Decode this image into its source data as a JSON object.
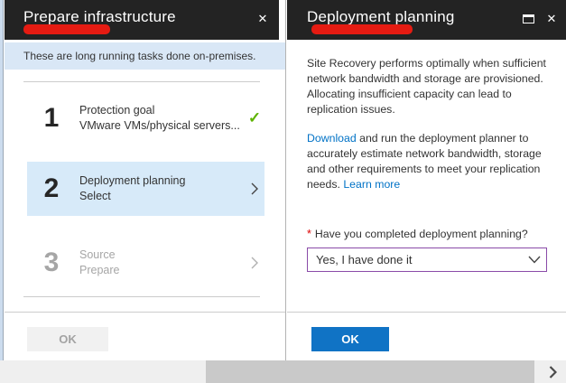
{
  "left_blade": {
    "title": "Prepare infrastructure",
    "banner_text": "These are long running tasks done on-premises.",
    "steps": [
      {
        "number": "1",
        "title": "Protection goal",
        "subtitle": "VMware VMs/physical servers...",
        "state": "completed"
      },
      {
        "number": "2",
        "title": "Deployment planning",
        "subtitle": "Select",
        "state": "selected"
      },
      {
        "number": "3",
        "title": "Source",
        "subtitle": "Prepare",
        "state": "disabled"
      }
    ],
    "ok_button": {
      "label": "OK",
      "enabled": false
    }
  },
  "right_blade": {
    "title": "Deployment planning",
    "intro_paragraph": "Site Recovery performs optimally when sufficient network bandwidth and storage are provisioned. Allocating insufficient capacity can lead to replication issues.",
    "planner_paragraph": {
      "download_link": "Download",
      "middle_text": " and run the deployment planner to accurately estimate network bandwidth, storage and other requirements to meet your replication needs. ",
      "learn_more_link": "Learn more"
    },
    "question": {
      "required_marker": "*",
      "label": "Have you completed deployment planning?"
    },
    "dropdown": {
      "selected_value": "Yes, I have done it"
    },
    "ok_button": {
      "label": "OK",
      "enabled": true
    }
  },
  "icons": {
    "close": "✕",
    "check": "✓"
  },
  "colors": {
    "header_bg": "#232323",
    "banner_bg": "#d9e7f6",
    "selected_step_bg": "#d7eaf9",
    "link_blue": "#0072c6",
    "primary_button_bg": "#1073c5",
    "completed_check_green": "#5db300",
    "required_red": "#dd0000",
    "dropdown_border_purple": "#8a4ba8",
    "redaction_red": "#e51b12",
    "scrollbar_thumb": "#c9c9c9"
  },
  "scrollbar": {
    "orientation": "horizontal"
  }
}
